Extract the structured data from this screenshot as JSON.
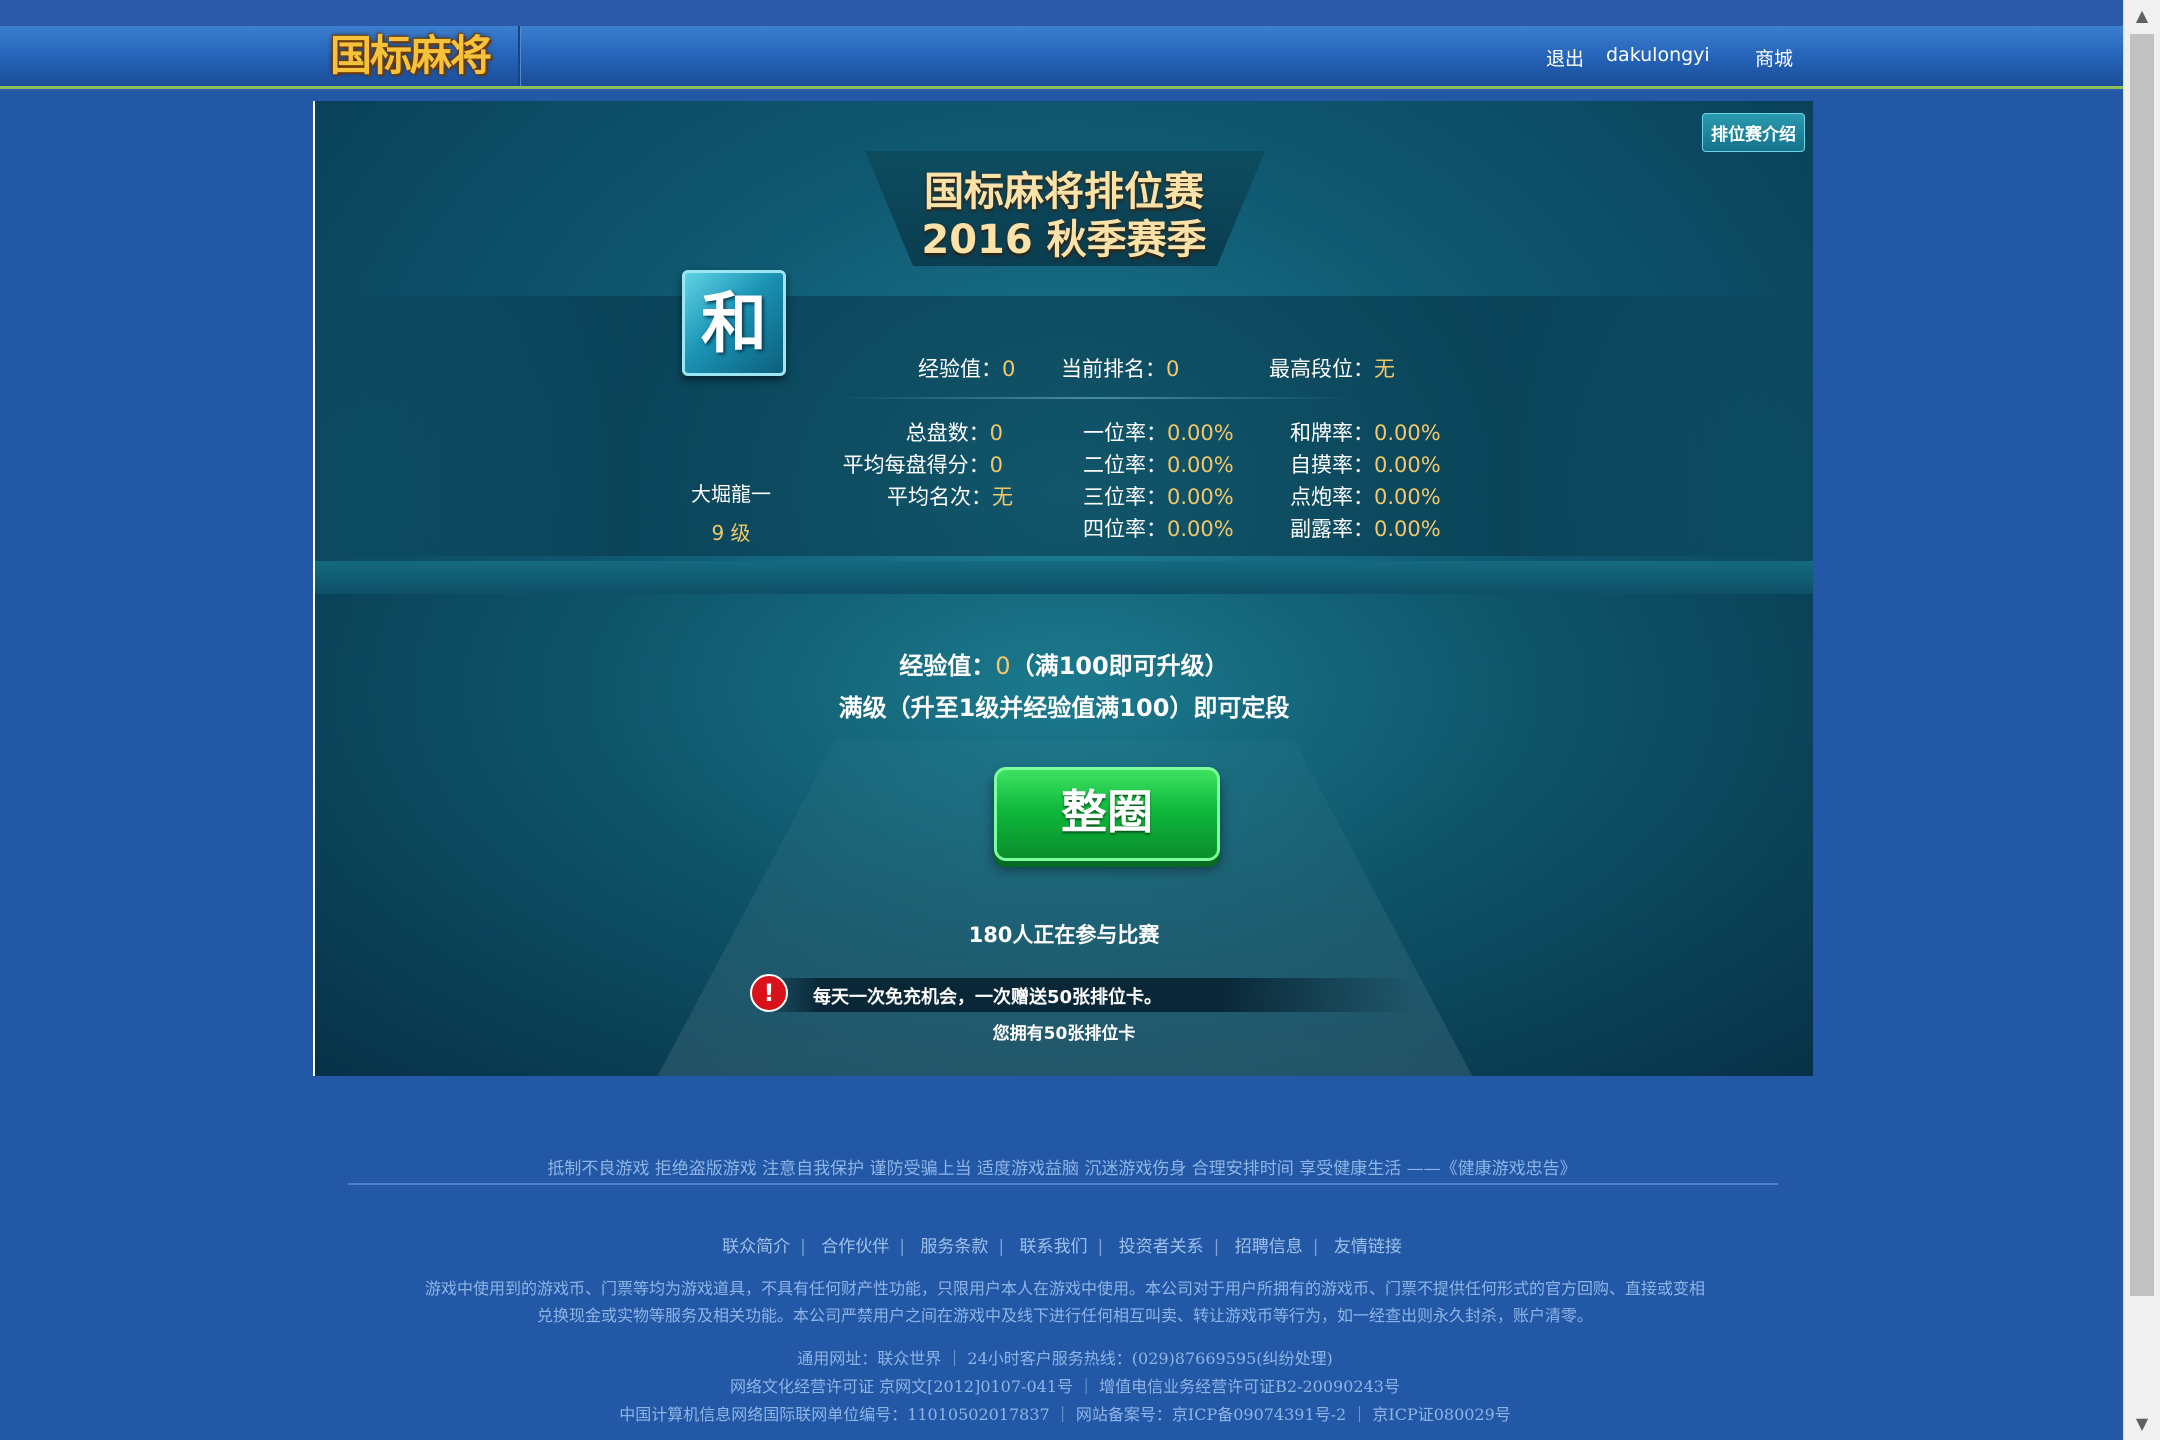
{
  "nav": {
    "logo": "国标麻将",
    "logout": "退出",
    "username": "dakulongyi",
    "shop": "商城"
  },
  "panel": {
    "intro_button": "排位赛介绍",
    "title_line1": "国标麻将排位赛",
    "title_line2": "2016 秋季赛季",
    "avatar_glyph": "和",
    "player_name": "大堀龍一",
    "level": "9  级",
    "top_stats": [
      {
        "label": "经验值：",
        "value": "0"
      },
      {
        "label": "当前排名：",
        "value": "0"
      },
      {
        "label": "最高段位：",
        "value": "无"
      }
    ],
    "left_stats": [
      {
        "label": "总盘数：",
        "value": "0"
      },
      {
        "label": "平均每盘得分：",
        "value": "0"
      },
      {
        "label": "平均名次：",
        "value": "无"
      }
    ],
    "mid_stats": [
      {
        "label": "一位率：",
        "value": "0.00%"
      },
      {
        "label": "二位率：",
        "value": "0.00%"
      },
      {
        "label": "三位率：",
        "value": "0.00%"
      },
      {
        "label": "四位率：",
        "value": "0.00%"
      }
    ],
    "right_stats": [
      {
        "label": "和牌率：",
        "value": "0.00%"
      },
      {
        "label": "自摸率：",
        "value": "0.00%"
      },
      {
        "label": "点炮率：",
        "value": "0.00%"
      },
      {
        "label": "副露率：",
        "value": "0.00%"
      }
    ],
    "exp_prefix": "经验值：",
    "exp_value": "0",
    "exp_suffix": "（满100即可升级）",
    "full_level_note": "满级（升至1级并经验值满100）即可定段",
    "main_button": "整圈",
    "participants": "180人正在参与比赛",
    "notice": "每天一次免充机会，一次赠送50张排位卡。",
    "card_count": "您拥有50张排位卡"
  },
  "footer": {
    "health_warning": "抵制不良游戏  拒绝盗版游戏  注意自我保护  谨防受骗上当  适度游戏益脑  沉迷游戏伤身  合理安排时间  享受健康生活  ——《健康游戏忠告》",
    "links": [
      "联众简介",
      "合作伙伴",
      "服务条款",
      "联系我们",
      "投资者关系",
      "招聘信息",
      "友情链接"
    ],
    "disclaimer_line1": "游戏中使用到的游戏币、门票等均为游戏道具，不具有任何财产性功能，只限用户本人在游戏中使用。本公司对于用户所拥有的游戏币、门票不提供任何形式的官方回购、直接或变相",
    "disclaimer_line2": "兑换现金或实物等服务及相关功能。本公司严禁用户之间在游戏中及线下进行任何相互叫卖、转让游戏币等行为，如一经查出则永久封杀，账户清零。",
    "contact": "通用网址：联众世界 ｜ 24小时客户服务热线：(029)87669595(纠纷处理)",
    "license1": "网络文化经营许可证   京网文[2012]0107-041号 ｜ 增值电信业务经营许可证B2-20090243号",
    "license2": "中国计算机信息网络国际联网单位编号：11010502017837 ｜ 网站备案号：京ICP备09074391号-2 ｜ 京ICP证080029号"
  }
}
